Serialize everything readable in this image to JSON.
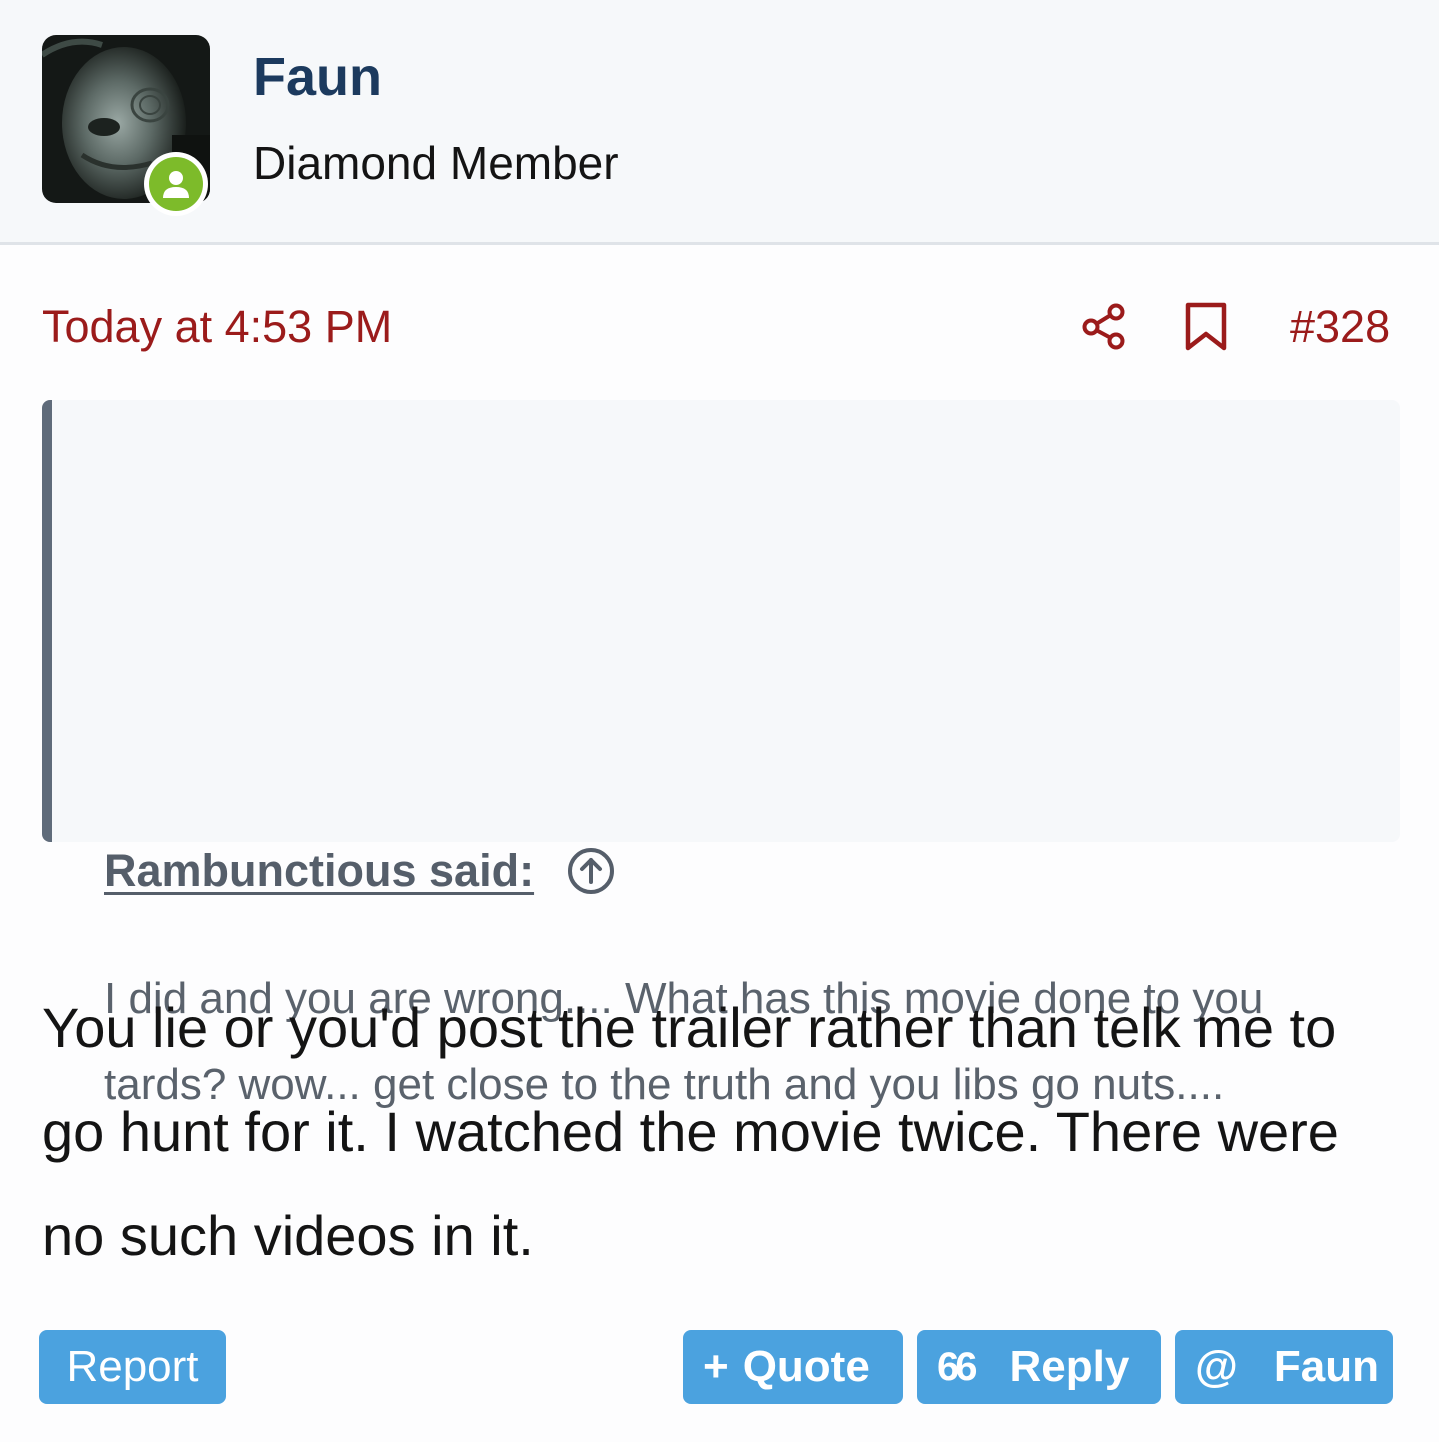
{
  "user": {
    "name": "Faun",
    "title": "Diamond Member",
    "status": "online"
  },
  "post": {
    "timestamp": "Today at 4:53 PM",
    "number": "#328",
    "body": "You lie or you'd post the trailer rather than telk me to go hunt for it. I watched the movie twice. There were no such videos in it."
  },
  "quote": {
    "author_label": "Rambunctious said:",
    "text": "I did and you are wrong.... What has this movie done to you tards? wow... get close to the truth and you libs go nuts...."
  },
  "actions": {
    "report": "Report",
    "quote": "Quote",
    "quote_glyph": "+",
    "reply": "Reply",
    "reply_glyph": "66",
    "mention": "Faun",
    "mention_glyph": "@"
  },
  "colors": {
    "accent_red": "#9b1b1b",
    "username_blue": "#1c3a5e",
    "button_blue": "#4ba2df",
    "online_green": "#7dbb2a",
    "quote_bar": "#5f6b7a"
  },
  "icons": {
    "share": "share-icon",
    "bookmark": "bookmark-icon",
    "quote_jump": "arrow-up-circle-icon",
    "online": "user-online-icon"
  }
}
